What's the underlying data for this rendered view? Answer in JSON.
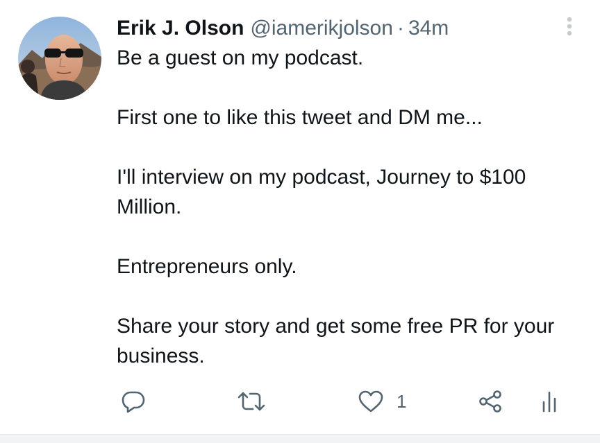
{
  "tweet": {
    "author_name": "Erik J. Olson",
    "handle": "@iamerikjolson",
    "separator": "·",
    "timestamp": "34m",
    "lines": [
      "Be a guest on my podcast.",
      "",
      "First one to like this tweet and DM me...",
      "",
      "I'll interview on my  podcast, Journey to $100 Million.",
      "",
      "Entrepreneurs only.",
      "",
      "Share your story and get some free PR for your business."
    ],
    "like_count": "1"
  },
  "icons": {
    "avatar": "profile-photo",
    "more": "more-vertical-icon",
    "reply": "reply-icon",
    "retweet": "retweet-icon",
    "like": "heart-icon",
    "share": "share-icon",
    "analytics": "analytics-icon"
  },
  "colors": {
    "text": "#0f1419",
    "secondary": "#536471",
    "icon": "#536471",
    "more_icon": "#c4c9cd"
  }
}
